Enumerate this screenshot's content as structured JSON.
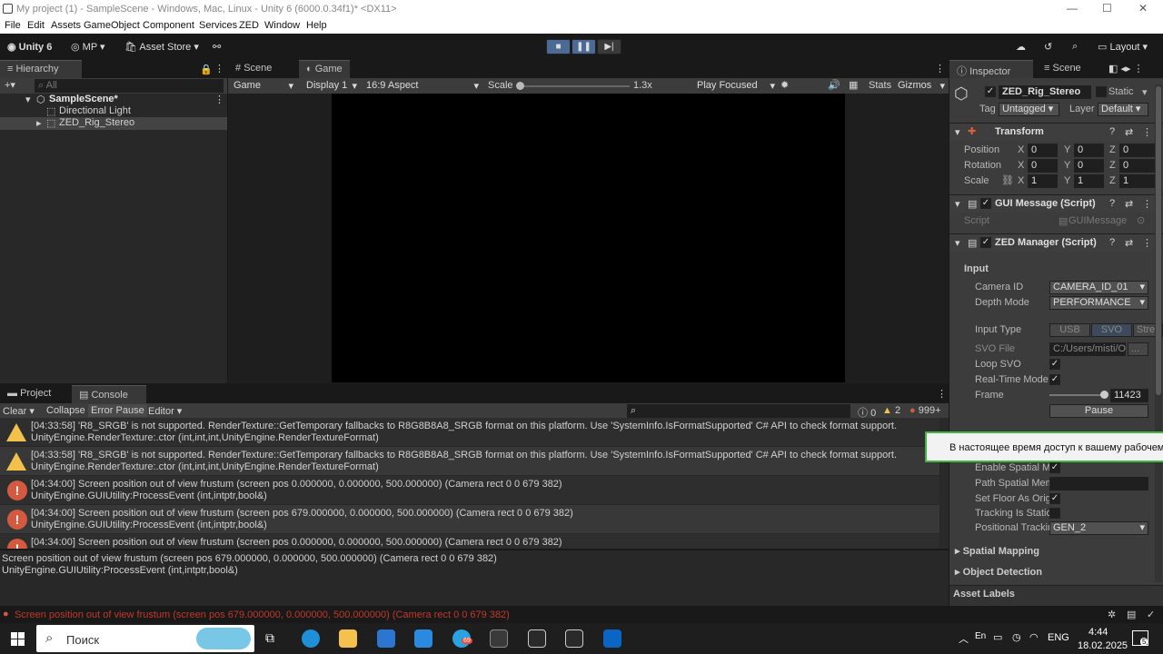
{
  "window": {
    "title": "My project (1) - SampleScene - Windows, Mac, Linux - Unity 6 (6000.0.34f1)* <DX11>",
    "minimize": "—",
    "maximize": "☐",
    "close": "✕"
  },
  "menu": [
    "File",
    "Edit",
    "Assets",
    "GameObject",
    "Component",
    "Services",
    "ZED",
    "Window",
    "Help"
  ],
  "toolbar": {
    "unity": "Unity 6",
    "account": "MP",
    "asset_store": "Asset Store",
    "layout": "Layout",
    "play": "▶",
    "pause": "❚❚",
    "step": "▶|"
  },
  "hierarchy": {
    "tab": "Hierarchy",
    "search_placeholder": "All",
    "scene": "SampleScene*",
    "items": [
      "Directional Light",
      "ZED_Rig_Stereo"
    ]
  },
  "center": {
    "tabs": [
      "Scene",
      "Game"
    ],
    "game_dropdown": "Game",
    "display": "Display 1",
    "aspect": "16:9 Aspect",
    "scale_label": "Scale",
    "scale_value": "1.3x",
    "play_focused": "Play Focused",
    "stats": "Stats",
    "gizmos": "Gizmos"
  },
  "bottom": {
    "tabs": [
      "Project",
      "Console"
    ],
    "clear": "Clear",
    "collapse": "Collapse",
    "error_pause": "Error Pause",
    "editor": "Editor",
    "count_info": "0",
    "count_warn": "2",
    "count_error": "999+",
    "logs": [
      {
        "type": "warn",
        "line1": "[04:33:58] 'R8_SRGB' is not supported. RenderTexture::GetTemporary fallbacks to R8G8B8A8_SRGB format on this platform. Use 'SystemInfo.IsFormatSupported' C# API to check format support.",
        "line2": "UnityEngine.RenderTexture:.ctor (int,int,int,UnityEngine.RenderTextureFormat)"
      },
      {
        "type": "warn",
        "line1": "[04:33:58] 'R8_SRGB' is not supported. RenderTexture::GetTemporary fallbacks to R8G8B8A8_SRGB format on this platform. Use 'SystemInfo.IsFormatSupported' C# API to check format support.",
        "line2": "UnityEngine.RenderTexture:.ctor (int,int,int,UnityEngine.RenderTextureFormat)"
      },
      {
        "type": "error",
        "line1": "[04:34:00] Screen position out of view frustum (screen pos 0.000000, 0.000000, 500.000000) (Camera rect 0 0 679 382)",
        "line2": "UnityEngine.GUIUtility:ProcessEvent (int,intptr,bool&)"
      },
      {
        "type": "error",
        "line1": "[04:34:00] Screen position out of view frustum (screen pos 679.000000, 0.000000, 500.000000) (Camera rect 0 0 679 382)",
        "line2": "UnityEngine.GUIUtility:ProcessEvent (int,intptr,bool&)"
      },
      {
        "type": "error",
        "line1": "[04:34:00] Screen position out of view frustum (screen pos 0.000000, 0.000000, 500.000000) (Camera rect 0 0 679 382)",
        "line2": ""
      }
    ],
    "detail_line1": "Screen position out of view frustum (screen pos 679.000000, 0.000000, 500.000000) (Camera rect 0 0 679 382)",
    "detail_line2": "UnityEngine.GUIUtility:ProcessEvent (int,intptr,bool&)"
  },
  "status_bar": "Screen position out of view frustum (screen pos 679.000000, 0.000000, 500.000000) (Camera rect 0 0 679 382)",
  "inspector": {
    "tabs": [
      "Inspector",
      "Scene"
    ],
    "object_name": "ZED_Rig_Stereo",
    "static": "Static",
    "tag_label": "Tag",
    "tag": "Untagged",
    "layer_label": "Layer",
    "layer": "Default",
    "transform": {
      "title": "Transform",
      "position": {
        "label": "Position",
        "x": "0",
        "y": "0",
        "z": "0"
      },
      "rotation": {
        "label": "Rotation",
        "x": "0",
        "y": "0",
        "z": "0"
      },
      "scale": {
        "label": "Scale",
        "x": "1",
        "y": "1",
        "z": "1"
      }
    },
    "gui_message": {
      "title": "GUI Message (Script)",
      "script_label": "Script",
      "script": "GUIMessage"
    },
    "zed_manager": {
      "title": "ZED Manager (Script)",
      "input_header": "Input",
      "camera_id_label": "Camera ID",
      "camera_id": "CAMERA_ID_01",
      "depth_mode_label": "Depth Mode",
      "depth_mode": "PERFORMANCE",
      "input_type_label": "Input Type",
      "input_types": [
        "USB",
        "SVO",
        "Stre"
      ],
      "svo_file_label": "SVO File",
      "svo_file": "C:/Users/misti/O",
      "svo_browse": "...",
      "loop_svo_label": "Loop SVO",
      "realtime_label": "Real-Time Mode",
      "frame_label": "Frame",
      "frame": "11423",
      "pause": "Pause",
      "enable_spatial_label": "Enable Spatial Me",
      "path_spatial_label": "Path Spatial Mem",
      "set_floor_label": "Set Floor As Orig",
      "tracking_static_label": "Tracking Is Static",
      "positional_label": "Positional Trackin",
      "positional": "GEN_2",
      "spatial_mapping": "Spatial Mapping",
      "object_detection": "Object Detection"
    },
    "asset_labels": "Asset Labels",
    "notification": "В настоящее время доступ к вашему рабочему сто"
  },
  "taskbar": {
    "search": "Поиск",
    "lang": "ENG",
    "time": "4:44",
    "date": "18.02.2025",
    "badge": "69",
    "notif_count": "5"
  },
  "colors": {
    "accent": "#4b6a96",
    "warn": "#f0c24b",
    "error": "#d45a3f",
    "notify_border": "#46b34a"
  }
}
